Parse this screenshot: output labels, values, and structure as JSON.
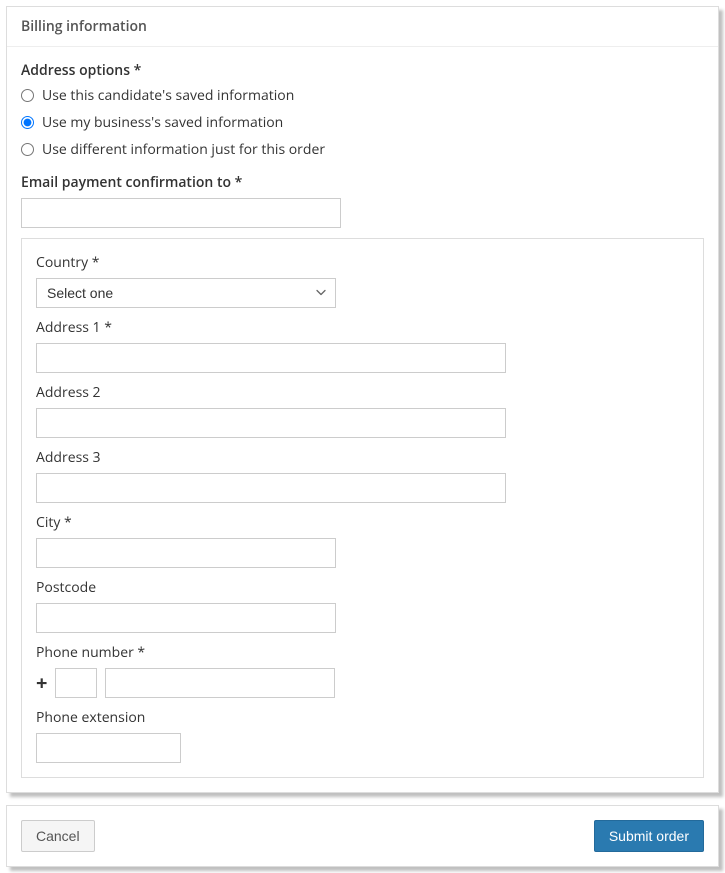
{
  "header": {
    "title": "Billing information"
  },
  "addressOptions": {
    "label": "Address options *",
    "options": [
      {
        "label": "Use this candidate's saved information",
        "checked": false
      },
      {
        "label": "Use my business's saved information",
        "checked": true
      },
      {
        "label": "Use different information just for this order",
        "checked": false
      }
    ]
  },
  "emailConfirmation": {
    "label": "Email payment confirmation to *",
    "value": ""
  },
  "address": {
    "country": {
      "label": "Country *",
      "placeholder": "Select one",
      "value": ""
    },
    "address1": {
      "label": "Address 1 *",
      "value": ""
    },
    "address2": {
      "label": "Address 2",
      "value": ""
    },
    "address3": {
      "label": "Address 3",
      "value": ""
    },
    "city": {
      "label": "City *",
      "value": ""
    },
    "postcode": {
      "label": "Postcode",
      "value": ""
    },
    "phone": {
      "label": "Phone number *",
      "cc": "",
      "number": ""
    },
    "ext": {
      "label": "Phone extension",
      "value": ""
    }
  },
  "buttons": {
    "cancel": "Cancel",
    "submit": "Submit order"
  },
  "icons": {
    "plus": "+"
  }
}
